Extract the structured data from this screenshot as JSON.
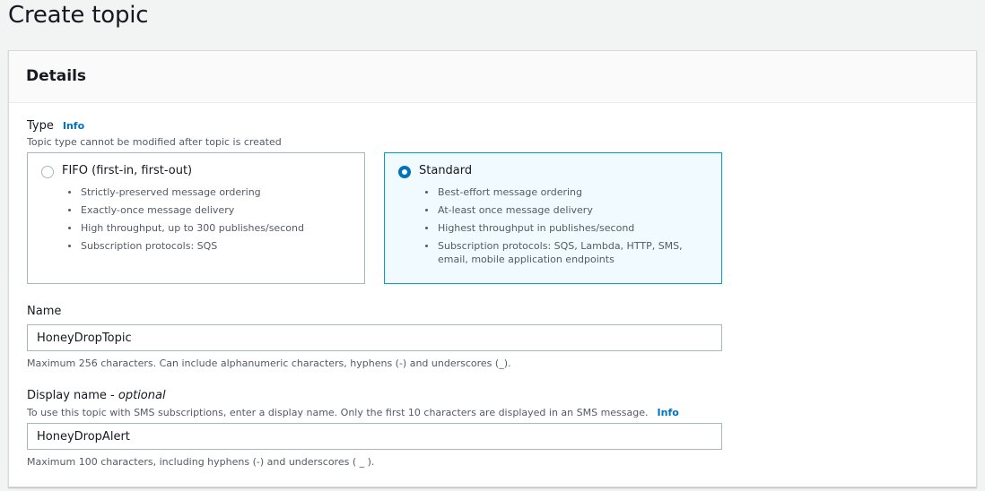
{
  "page": {
    "title": "Create topic"
  },
  "details": {
    "heading": "Details",
    "type": {
      "label": "Type",
      "info": "Info",
      "description": "Topic type cannot be modified after topic is created",
      "options": [
        {
          "title": "FIFO (first-in, first-out)",
          "selected": false,
          "bullets": [
            "Strictly-preserved message ordering",
            "Exactly-once message delivery",
            "High throughput, up to 300 publishes/second",
            "Subscription protocols: SQS"
          ]
        },
        {
          "title": "Standard",
          "selected": true,
          "bullets": [
            "Best-effort message ordering",
            "At-least once message delivery",
            "Highest throughput in publishes/second",
            "Subscription protocols: SQS, Lambda, HTTP, SMS, email, mobile application endpoints"
          ]
        }
      ]
    },
    "name": {
      "label": "Name",
      "value": "HoneyDropTopic",
      "hint": "Maximum 256 characters. Can include alphanumeric characters, hyphens (-) and underscores (_)."
    },
    "display_name": {
      "label": "Display name",
      "optional": "optional",
      "description": "To use this topic with SMS subscriptions, enter a display name. Only the first 10 characters are displayed in an SMS message.",
      "info": "Info",
      "value": "HoneyDropAlert",
      "hint": "Maximum 100 characters, including hyphens (-) and underscores ( _ )."
    }
  }
}
